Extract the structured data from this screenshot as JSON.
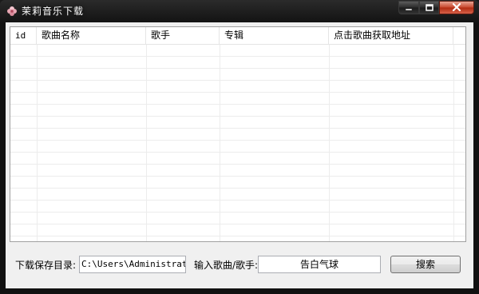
{
  "window": {
    "title": "茉莉音乐下载"
  },
  "table": {
    "columns": [
      {
        "label": "id"
      },
      {
        "label": "歌曲名称"
      },
      {
        "label": "歌手"
      },
      {
        "label": "专辑"
      },
      {
        "label": "点击歌曲获取地址"
      }
    ],
    "rows": []
  },
  "footer": {
    "save_dir_label": "下载保存目录:",
    "save_dir_value": "C:\\Users\\Administrator\\D",
    "search_label": "输入歌曲/歌手:",
    "search_value": "告白气球",
    "search_button": "搜索"
  },
  "icons": {
    "app": "flower-icon",
    "minimize": "minimize-icon",
    "maximize": "maximize-icon",
    "close": "close-icon"
  },
  "colors": {
    "close_button": "#c8452b",
    "frame": "#1a1a1a",
    "client": "#f0f0f0"
  }
}
